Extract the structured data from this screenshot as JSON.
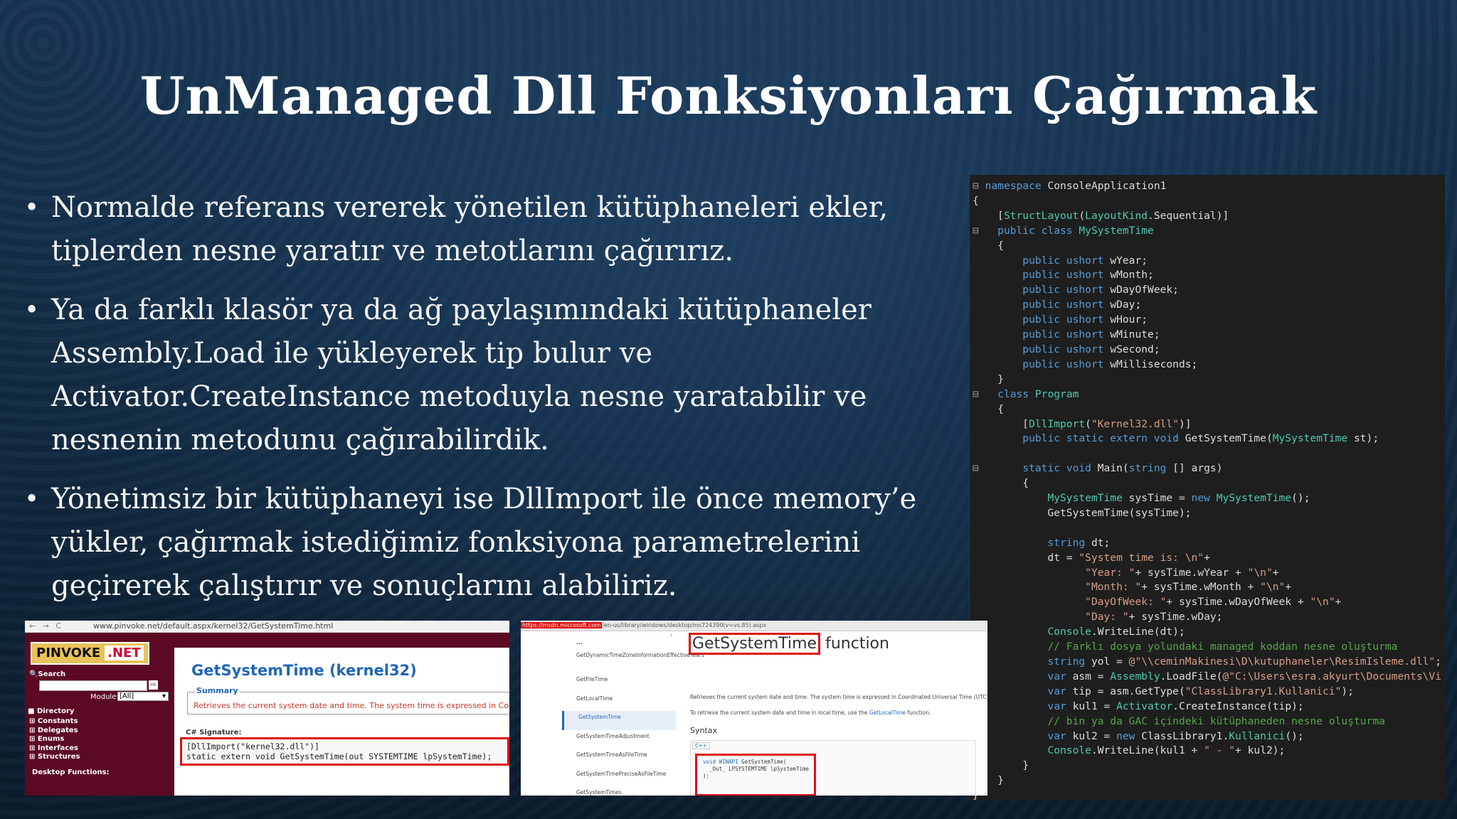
{
  "slide": {
    "title": "UnManaged Dll Fonksiyonları Çağırmak",
    "bullets": [
      "Normalde referans vererek yönetilen kütüphaneleri ekler, tiplerden nesne yaratır ve metotlarını çağırırız.",
      "Ya da farklı klasör ya da ağ paylaşımındaki kütüphaneler Assembly.Load ile yükleyerek tip bulur ve Activator.CreateInstance metoduyla nesne yaratabilir ve nesnenin metodunu çağırabilirdik.",
      "Yönetimsiz bir kütüphaneyi ise DllImport ile önce memory’e yükler, çağırmak istediğimiz fonksiyona parametrelerini geçirerek çalıştırır ve sonuçlarını alabiliriz."
    ]
  },
  "colors": {
    "code_bg": "#1e1e1e",
    "keyword": "#569cd6",
    "type": "#4ec9b0",
    "string": "#d69d85",
    "comment": "#57a64a",
    "highlight_red": "#dd1111",
    "pinvoke_maroon": "#5c0a24",
    "link_blue": "#2166b8"
  },
  "code": {
    "lines": [
      [
        [
          "mk",
          "⊟"
        ],
        [
          "kw",
          "namespace"
        ],
        [
          "",
          "ConsoleApplication1"
        ]
      ],
      [
        [
          "",
          "{"
        ]
      ],
      [
        [
          "",
          "    ["
        ],
        [
          "ty",
          "StructLayout"
        ],
        [
          "",
          "("
        ],
        [
          "ty",
          "LayoutKind"
        ],
        [
          "",
          ".Sequential)]"
        ]
      ],
      [
        [
          "mk",
          "⊟"
        ],
        [
          "",
          "   "
        ],
        [
          "kw",
          "public class"
        ],
        [
          "",
          ""
        ],
        [
          "ty",
          "MySystemTime"
        ]
      ],
      [
        [
          "",
          "    {"
        ]
      ],
      [
        [
          "",
          "        "
        ],
        [
          "kw",
          "public ushort"
        ],
        [
          "",
          "wYear;"
        ]
      ],
      [
        [
          "",
          "        "
        ],
        [
          "kw",
          "public ushort"
        ],
        [
          "",
          "wMonth;"
        ]
      ],
      [
        [
          "",
          "        "
        ],
        [
          "kw",
          "public ushort"
        ],
        [
          "",
          "wDayOfWeek;"
        ]
      ],
      [
        [
          "",
          "        "
        ],
        [
          "kw",
          "public ushort"
        ],
        [
          "",
          "wDay;"
        ]
      ],
      [
        [
          "",
          "        "
        ],
        [
          "kw",
          "public ushort"
        ],
        [
          "",
          "wHour;"
        ]
      ],
      [
        [
          "",
          "        "
        ],
        [
          "kw",
          "public ushort"
        ],
        [
          "",
          "wMinute;"
        ]
      ],
      [
        [
          "",
          "        "
        ],
        [
          "kw",
          "public ushort"
        ],
        [
          "",
          "wSecond;"
        ]
      ],
      [
        [
          "",
          "        "
        ],
        [
          "kw",
          "public ushort"
        ],
        [
          "",
          "wMilliseconds;"
        ]
      ],
      [
        [
          "",
          "    }"
        ]
      ],
      [
        [
          "mk",
          "⊟"
        ],
        [
          "",
          "   "
        ],
        [
          "kw",
          "class"
        ],
        [
          "",
          ""
        ],
        [
          "ty",
          "Program"
        ]
      ],
      [
        [
          "",
          "    {"
        ]
      ],
      [
        [
          "",
          "        ["
        ],
        [
          "ty",
          "DllImport"
        ],
        [
          "",
          "("
        ],
        [
          "st",
          "\"Kernel32.dll\""
        ],
        [
          "",
          ")]"
        ]
      ],
      [
        [
          "",
          "        "
        ],
        [
          "kw",
          "public static extern void"
        ],
        [
          "",
          "GetSystemTime("
        ],
        [
          "ty",
          "MySystemTime"
        ],
        [
          "",
          "st);"
        ]
      ],
      [
        [
          "",
          ""
        ]
      ],
      [
        [
          "mk",
          "⊟"
        ],
        [
          "",
          "       "
        ],
        [
          "kw",
          "static void"
        ],
        [
          "",
          "Main("
        ],
        [
          "kw",
          "string"
        ],
        [
          "",
          "[] args)"
        ]
      ],
      [
        [
          "",
          "        {"
        ]
      ],
      [
        [
          "",
          "            "
        ],
        [
          "ty",
          "MySystemTime"
        ],
        [
          "",
          "sysTime = "
        ],
        [
          "kw",
          "new"
        ],
        [
          "",
          ""
        ],
        [
          "ty",
          "MySystemTime"
        ],
        [
          "",
          "();"
        ]
      ],
      [
        [
          "",
          "            GetSystemTime(sysTime);"
        ]
      ],
      [
        [
          "",
          ""
        ]
      ],
      [
        [
          "",
          "            "
        ],
        [
          "kw",
          "string"
        ],
        [
          "",
          "dt;"
        ]
      ],
      [
        [
          "",
          "            dt = "
        ],
        [
          "st",
          "\"System time is: \\n\""
        ],
        [
          "",
          "+"
        ]
      ],
      [
        [
          "",
          "                  "
        ],
        [
          "st",
          "\"Year: \""
        ],
        [
          "",
          "+ sysTime.wYear + "
        ],
        [
          "st",
          "\"\\n\""
        ],
        [
          "",
          "+"
        ]
      ],
      [
        [
          "",
          "                  "
        ],
        [
          "st",
          "\"Month: \""
        ],
        [
          "",
          "+ sysTime.wMonth + "
        ],
        [
          "st",
          "\"\\n\""
        ],
        [
          "",
          "+"
        ]
      ],
      [
        [
          "",
          "                  "
        ],
        [
          "st",
          "\"DayOfWeek: \""
        ],
        [
          "",
          "+ sysTime.wDayOfWeek + "
        ],
        [
          "st",
          "\"\\n\""
        ],
        [
          "",
          "+"
        ]
      ],
      [
        [
          "",
          "                  "
        ],
        [
          "st",
          "\"Day: \""
        ],
        [
          "",
          "+ sysTime.wDay;"
        ]
      ],
      [
        [
          "",
          "            "
        ],
        [
          "ty",
          "Console"
        ],
        [
          "",
          ".WriteLine(dt);"
        ]
      ],
      [
        [
          "",
          "            "
        ],
        [
          "cm",
          "// Farklı dosya yolundaki managed koddan nesne oluşturma"
        ]
      ],
      [
        [
          "",
          "            "
        ],
        [
          "kw",
          "string"
        ],
        [
          "",
          "yol = "
        ],
        [
          "st",
          "@\"\\\\ceminMakinesi\\D\\kutuphaneler\\ResimIsleme.dll\""
        ],
        [
          "",
          ";"
        ]
      ],
      [
        [
          "",
          "            "
        ],
        [
          "kw",
          "var"
        ],
        [
          "",
          "asm = "
        ],
        [
          "ty",
          "Assembly"
        ],
        [
          "",
          ".LoadFile("
        ],
        [
          "st",
          "@\"C:\\Users\\esra.akyurt\\Documents\\Vi"
        ]
      ],
      [
        [
          "",
          "            "
        ],
        [
          "kw",
          "var"
        ],
        [
          "",
          "tip = asm.GetType("
        ],
        [
          "st",
          "\"ClassLibrary1.Kullanici\""
        ],
        [
          "",
          ");"
        ]
      ],
      [
        [
          "",
          "            "
        ],
        [
          "kw",
          "var"
        ],
        [
          "",
          "kul1 = "
        ],
        [
          "ty",
          "Activator"
        ],
        [
          "",
          ".CreateInstance(tip);"
        ]
      ],
      [
        [
          "",
          "            "
        ],
        [
          "cm",
          "// bin ya da GAC içindeki kütüphaneden nesne oluşturma"
        ]
      ],
      [
        [
          "",
          "            "
        ],
        [
          "kw",
          "var"
        ],
        [
          "",
          "kul2 = "
        ],
        [
          "kw",
          "new"
        ],
        [
          "",
          "ClassLibrary1."
        ],
        [
          "ty",
          "Kullanici"
        ],
        [
          "",
          "();"
        ]
      ],
      [
        [
          "",
          "            "
        ],
        [
          "ty",
          "Console"
        ],
        [
          "",
          ".WriteLine(kul1 + "
        ],
        [
          "st",
          "\" - \""
        ],
        [
          "",
          "+ kul2);"
        ]
      ],
      [
        [
          "",
          "        }"
        ]
      ],
      [
        [
          "",
          "    }"
        ]
      ],
      [
        [
          "",
          "}"
        ]
      ]
    ]
  },
  "pinvoke": {
    "nav_buttons": "← → C",
    "url": "www.pinvoke.net/default.aspx/kernel32/GetSystemTime.html",
    "logo_left": "PINVOKE",
    "logo_right": ".NET",
    "search_label": "Search",
    "module_label": "Module:",
    "module_value": "[All]",
    "directory_label": "Directory",
    "directory_items": [
      "Constants",
      "Delegates",
      "Enums",
      "Interfaces",
      "Structures"
    ],
    "desktop_functions": "Desktop Functions:",
    "page_title": "GetSystemTime (kernel32)",
    "summary_label": "Summary",
    "summary_text": "Retrieves the current system date and time. The system time is expressed in Coordinated",
    "signature_label": "C# Signature:",
    "signature_line1": "[DllImport(\"kernel32.dll\")]",
    "signature_line2": "static extern void GetSystemTime(out SYSTEMTIME lpSystemTime);"
  },
  "msdn": {
    "url_prefix": "https://msdn.microsoft.com",
    "url_rest": "/en-us/library/windows/desktop/ms724390(v=vs.85).aspx",
    "nav_items": [
      "...",
      "GetDynamicTimeZoneInformationEffectiveYears",
      "GetFileTime",
      "GetLocalTime",
      "GetSystemTime",
      "GetSystemTimeAdjustment",
      "GetSystemTimeAsFileTime",
      "GetSystemTimePreciseAsFileTime",
      "GetSystemTimes"
    ],
    "active_index": 4,
    "title_boxed": "GetSystemTime",
    "title_rest": "function",
    "desc1": "Retrieves the current system date and time. The system time is expressed in Coordinated Universal Time (UTC).",
    "desc2_pre": "To retrieve the current system date and time in local time, use the ",
    "desc2_link": "GetLocalTime",
    "desc2_post": " function.",
    "syntax_label": "Syntax",
    "lang_tab": "C++",
    "code_line1_kw": "void WINAPI",
    "code_line1_rest": " GetSystemTime(",
    "code_line2": "  _Out_ LPSYSTEMTIME lpSystemTime",
    "code_line3": ");"
  }
}
